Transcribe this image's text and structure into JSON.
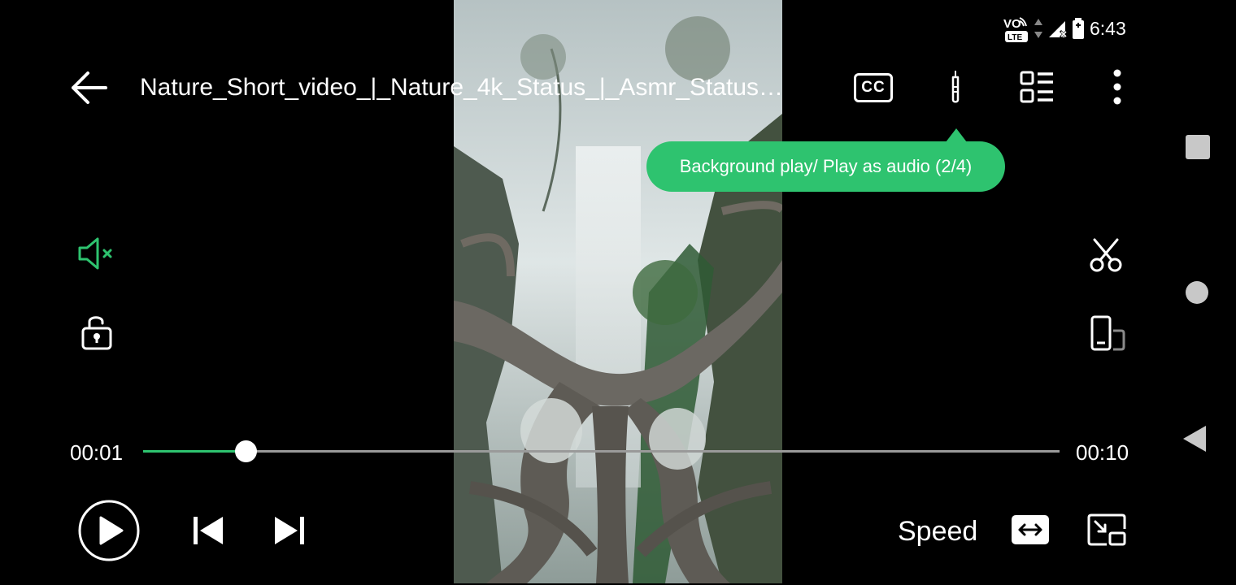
{
  "status_bar": {
    "network_label": "VO",
    "lte_label": "LTE",
    "time": "6:43"
  },
  "player": {
    "title": "Nature_Short_video_|_Nature_4k_Status_|_Asmr_Status…",
    "cc_label": "CC",
    "tooltip": "Background play/ Play as audio (2/4)",
    "current_time": "00:01",
    "total_time": "00:10",
    "progress_fraction": 0.112,
    "speed_label": "Speed"
  },
  "colors": {
    "accent": "#2ec36f",
    "background": "#000000",
    "track": "#9a9a9a"
  },
  "icons": {
    "back": "arrow-left-icon",
    "cc": "closed-captions-icon",
    "background_play": "headphone-jack-icon",
    "playlist": "playlist-icon",
    "more": "more-vertical-icon",
    "mute": "speaker-muted-icon",
    "lock": "unlock-icon",
    "cut": "scissors-icon",
    "rotate": "screen-rotate-icon",
    "play": "play-circle-icon",
    "previous": "skip-previous-icon",
    "next": "skip-next-icon",
    "aspect": "aspect-ratio-icon",
    "pip": "picture-in-picture-icon"
  }
}
